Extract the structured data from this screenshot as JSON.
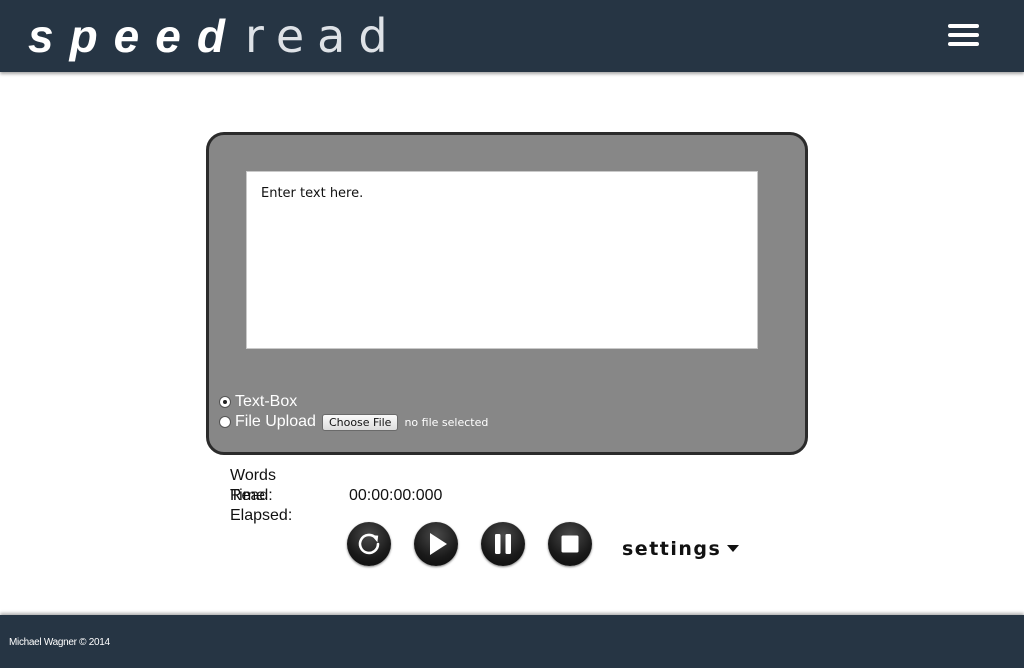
{
  "header": {
    "logo_bold": "speed",
    "logo_light": "read",
    "menu_icon": "hamburger-menu-icon"
  },
  "reader": {
    "textbox_value": "Enter text here.",
    "source_options": [
      {
        "label": "Text-Box",
        "checked": true
      },
      {
        "label": "File Upload",
        "checked": false
      }
    ],
    "choose_file_label": "Choose File",
    "file_status": "no file selected"
  },
  "stats": {
    "words_read_label": "Words Read:",
    "words_read_value": "",
    "time_elapsed_label": "Time Elapsed:",
    "time_elapsed_value": "00:00:00:000"
  },
  "controls": {
    "buttons": [
      {
        "name": "restart",
        "icon": "restart-icon"
      },
      {
        "name": "play",
        "icon": "play-icon"
      },
      {
        "name": "pause",
        "icon": "pause-icon"
      },
      {
        "name": "stop",
        "icon": "stop-icon"
      }
    ],
    "settings_label": "settings"
  },
  "footer": {
    "copyright": "Michael Wagner © 2014"
  },
  "colors": {
    "header_bg": "#263544",
    "panel_bg": "#878787",
    "panel_border": "#2b2b2b"
  }
}
